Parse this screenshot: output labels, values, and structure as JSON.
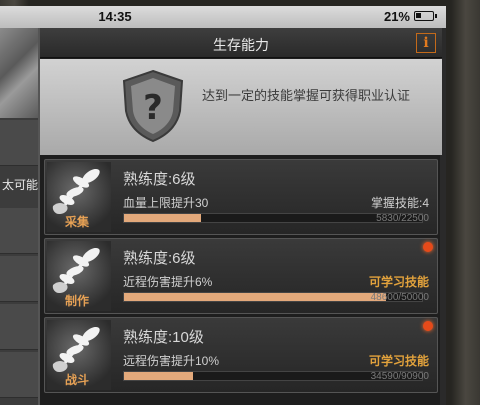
{
  "statusbar": {
    "time": "14:35",
    "battery": "21%"
  },
  "sidebar": {
    "label": "太可能"
  },
  "panel": {
    "title": "生存能力",
    "info_label": "i",
    "header_text": "达到一定的技能掌握可获得职业认证"
  },
  "cards": [
    {
      "category": "采集",
      "level": "熟练度:6级",
      "desc": "血量上限提升30",
      "right_label": "掌握技能:4",
      "exp": "5830/22500",
      "progress": 0.26
    },
    {
      "category": "制作",
      "level": "熟练度:6级",
      "desc": "近程伤害提升6%",
      "right_label": "可学习技能",
      "exp": "48600/50000",
      "progress": 0.88
    },
    {
      "category": "战斗",
      "level": "熟练度:10级",
      "desc": "远程伤害提升10%",
      "right_label": "可学习技能",
      "exp": "34590/90900",
      "progress": 0.23
    }
  ]
}
